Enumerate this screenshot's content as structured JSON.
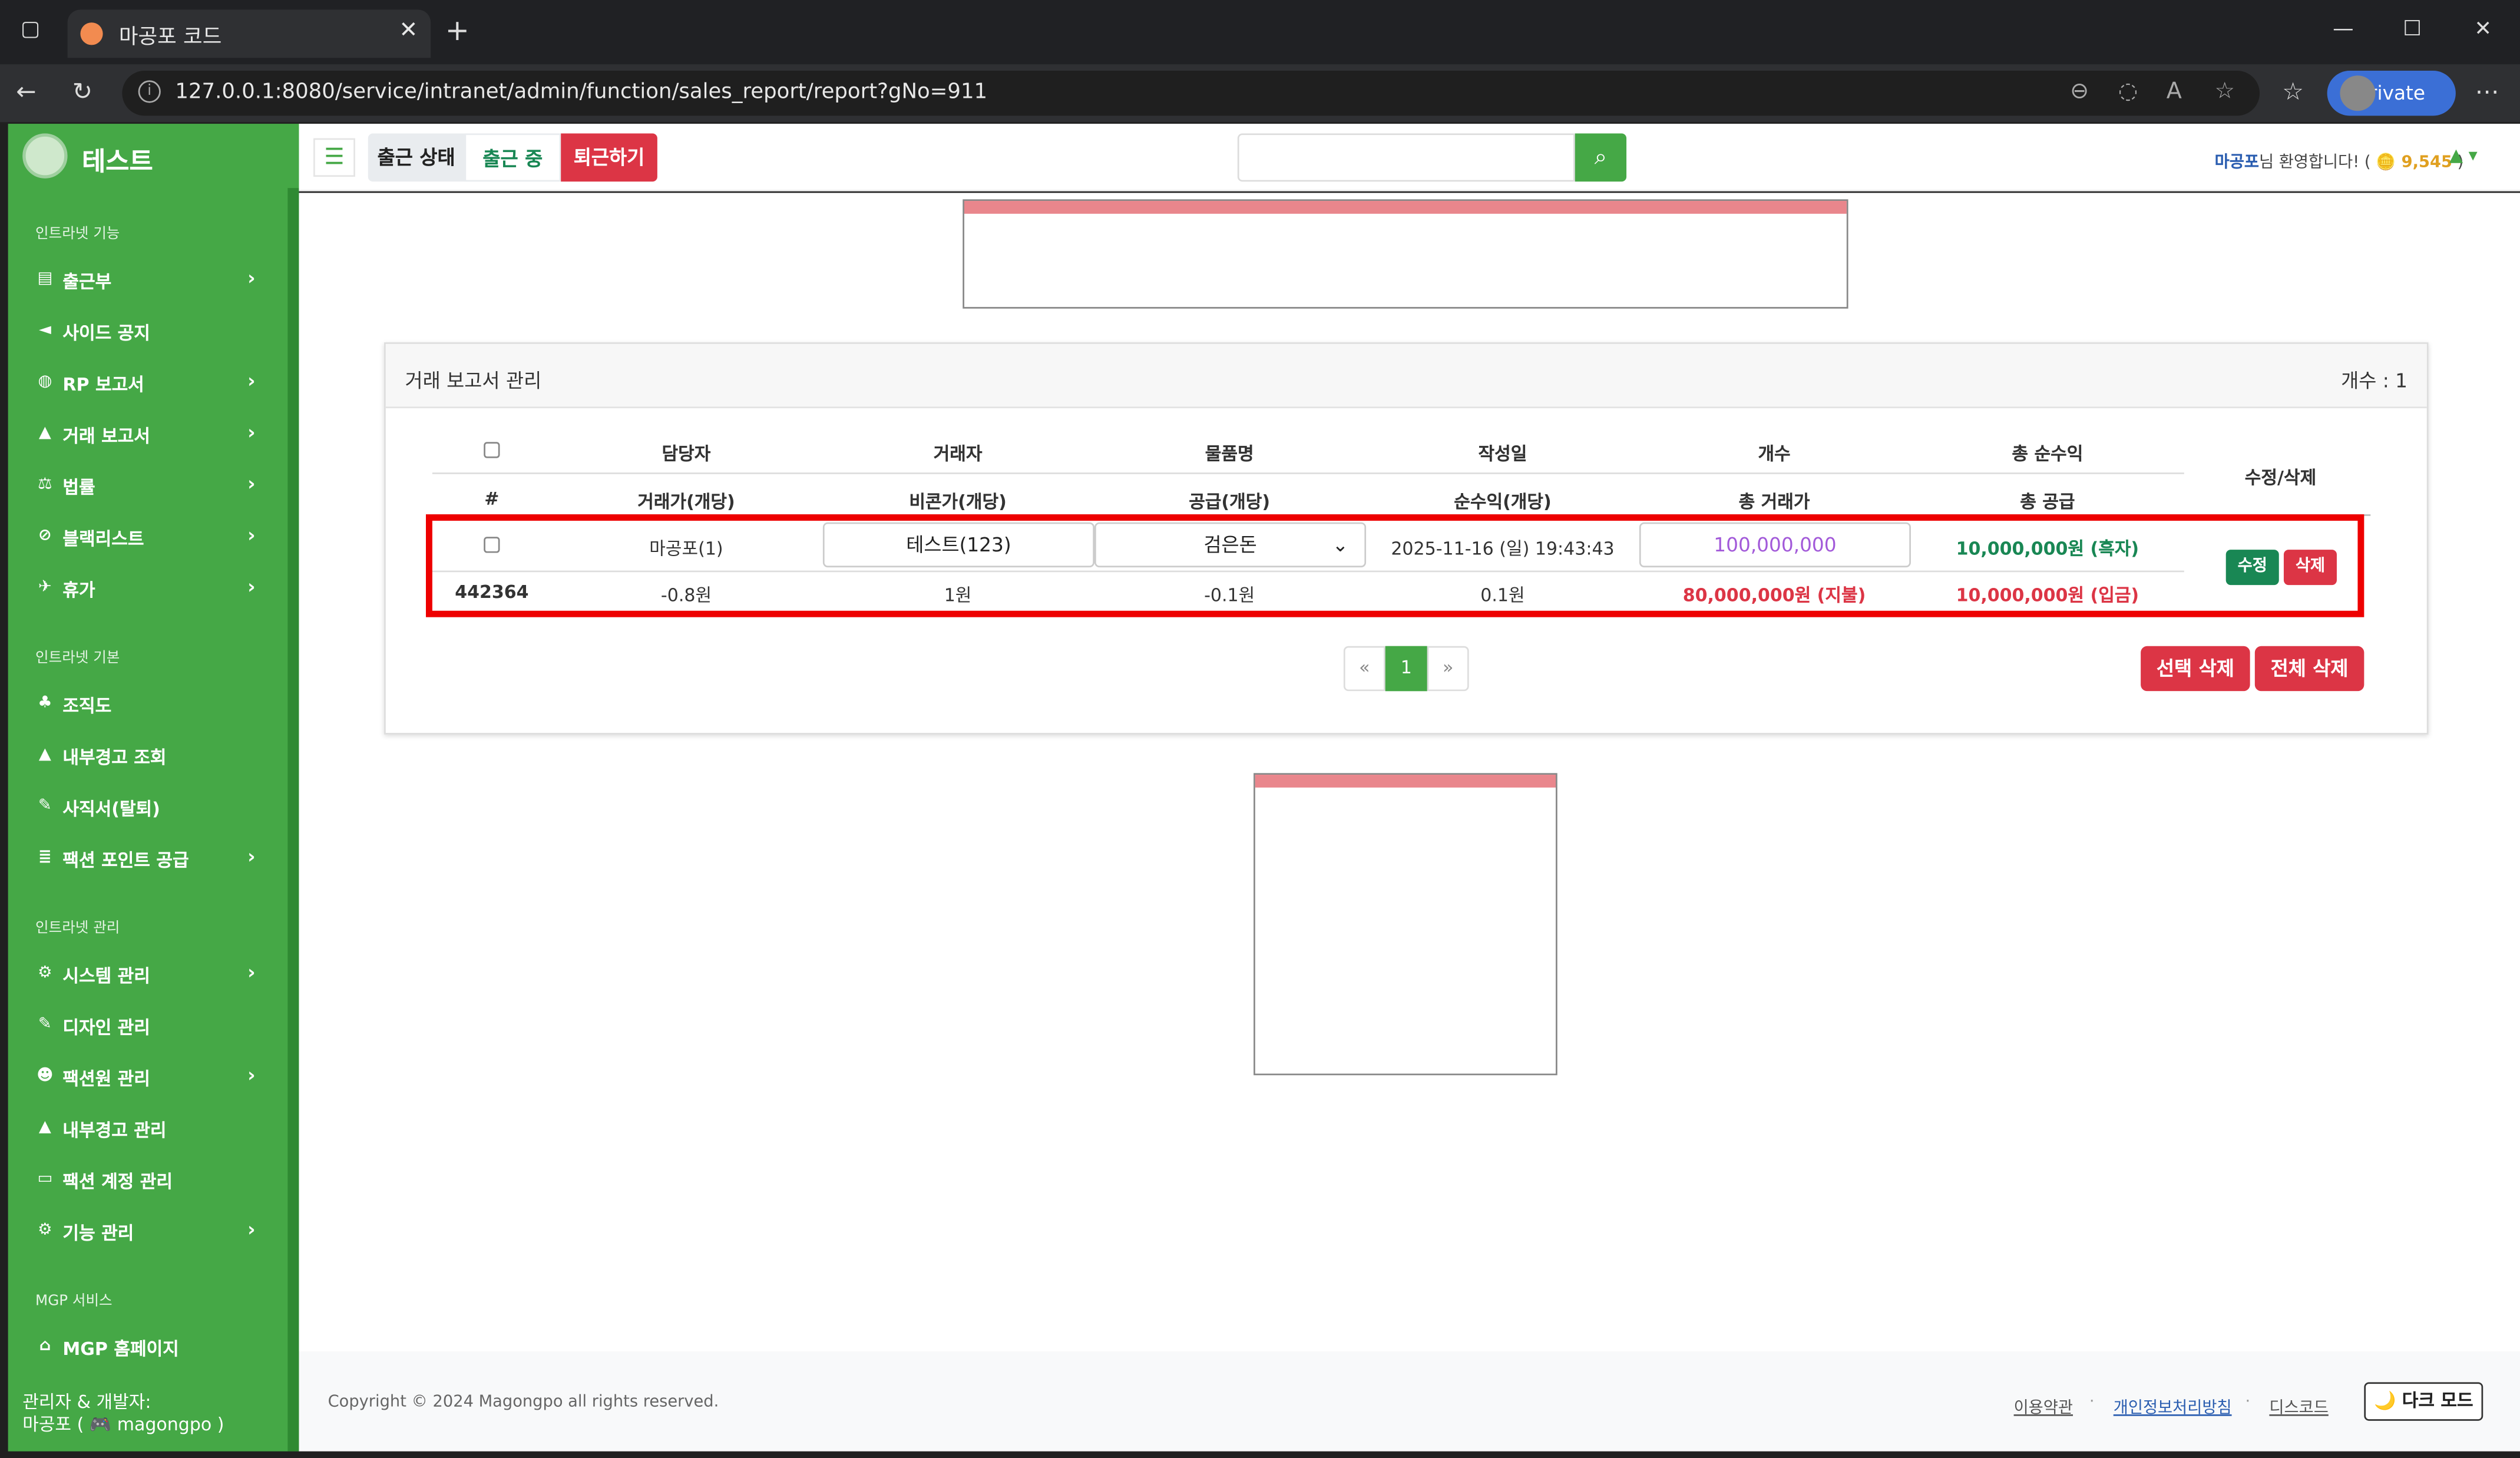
{
  "browser": {
    "tab_title": "마공포 코드",
    "url": "127.0.0.1:8080/service/intranet/admin/function/sales_report/report?gNo=911",
    "inprivate_label": "InPrivate"
  },
  "sidebar": {
    "brand": "테스트",
    "sections": [
      {
        "heading": "인트라넷 기능",
        "items": [
          {
            "label": "출근부",
            "icon": "book-icon",
            "chevron": true
          },
          {
            "label": "사이드 공지",
            "icon": "megaphone-icon",
            "chevron": false
          },
          {
            "label": "RP 보고서",
            "icon": "gamepad-icon",
            "chevron": true
          },
          {
            "label": "거래 보고서",
            "icon": "flask-icon",
            "chevron": true
          },
          {
            "label": "법률",
            "icon": "scale-icon",
            "chevron": true
          },
          {
            "label": "블랙리스트",
            "icon": "ban-icon",
            "chevron": true
          },
          {
            "label": "휴가",
            "icon": "plane-icon",
            "chevron": true
          }
        ]
      },
      {
        "heading": "인트라넷 기본",
        "items": [
          {
            "label": "조직도",
            "icon": "sitemap-icon",
            "chevron": false
          },
          {
            "label": "내부경고 조회",
            "icon": "warning-icon",
            "chevron": false
          },
          {
            "label": "사직서(탈퇴)",
            "icon": "pen-icon",
            "chevron": false
          },
          {
            "label": "팩션 포인트 공급",
            "icon": "coins-icon",
            "chevron": true
          }
        ]
      },
      {
        "heading": "인트라넷 관리",
        "items": [
          {
            "label": "시스템 관리",
            "icon": "gear-icon",
            "chevron": true
          },
          {
            "label": "디자인 관리",
            "icon": "brush-icon",
            "chevron": false
          },
          {
            "label": "팩션원 관리",
            "icon": "users-icon",
            "chevron": true
          },
          {
            "label": "내부경고 관리",
            "icon": "warning-icon",
            "chevron": false
          },
          {
            "label": "팩션 계정 관리",
            "icon": "id-card-icon",
            "chevron": false
          },
          {
            "label": "기능 관리",
            "icon": "cogs-icon",
            "chevron": true
          }
        ]
      },
      {
        "heading": "MGP 서비스",
        "items": [
          {
            "label": "MGP 홈페이지",
            "icon": "home-icon",
            "chevron": false
          }
        ]
      }
    ],
    "footer_line1": "관리자 & 개발자:",
    "footer_line2": "마공포 ( 🎮 magongpo )"
  },
  "topbar": {
    "status_label": "출근 상태",
    "status_value": "출근 중",
    "leave_button": "퇴근하기",
    "search_placeholder": "",
    "welcome_name": "마공포",
    "welcome_text": "님 환영합니다! (",
    "points": "🪙 9,545",
    "welcome_close": ")"
  },
  "report": {
    "title": "거래 보고서 관리",
    "count": "개수 : 1",
    "header_row1": [
      "담당자",
      "거래자",
      "물품명",
      "작성일",
      "개수",
      "총 순수익"
    ],
    "header_row2": [
      "#",
      "거래가(개당)",
      "비콘가(개당)",
      "공급(개당)",
      "순수익(개당)",
      "총 거래가",
      "총 공급"
    ],
    "action_header": "수정/삭제",
    "row": {
      "manager": "마공포(1)",
      "trader": "테스트(123)",
      "item": "검은돈",
      "date": "2025-11-16 (일) 19:43:43",
      "quantity": "100,000,000",
      "total_profit": "10,000,000원 (흑자)",
      "id": "442364",
      "price": "-0.8원",
      "beacon_price": "1원",
      "supply": "-0.1원",
      "profit_each": "0.1원",
      "total_price": "80,000,000원 (지불)",
      "total_supply": "10,000,000원 (입금)"
    },
    "edit_button": "수정",
    "delete_button": "삭제",
    "pager_prev": "«",
    "pager_page": "1",
    "pager_next": "»",
    "delete_selected": "선택 삭제",
    "delete_all": "전체 삭제",
    "colors": {
      "profit": "#198754",
      "loss": "#dc3545",
      "quantity": "#a259d9"
    }
  },
  "footer": {
    "copyright": "Copyright © 2024 Magongpo all rights reserved.",
    "links": [
      "이용약관",
      "개인정보처리방침",
      "디스코드"
    ],
    "dark_mode": "🌙 다크 모드"
  }
}
